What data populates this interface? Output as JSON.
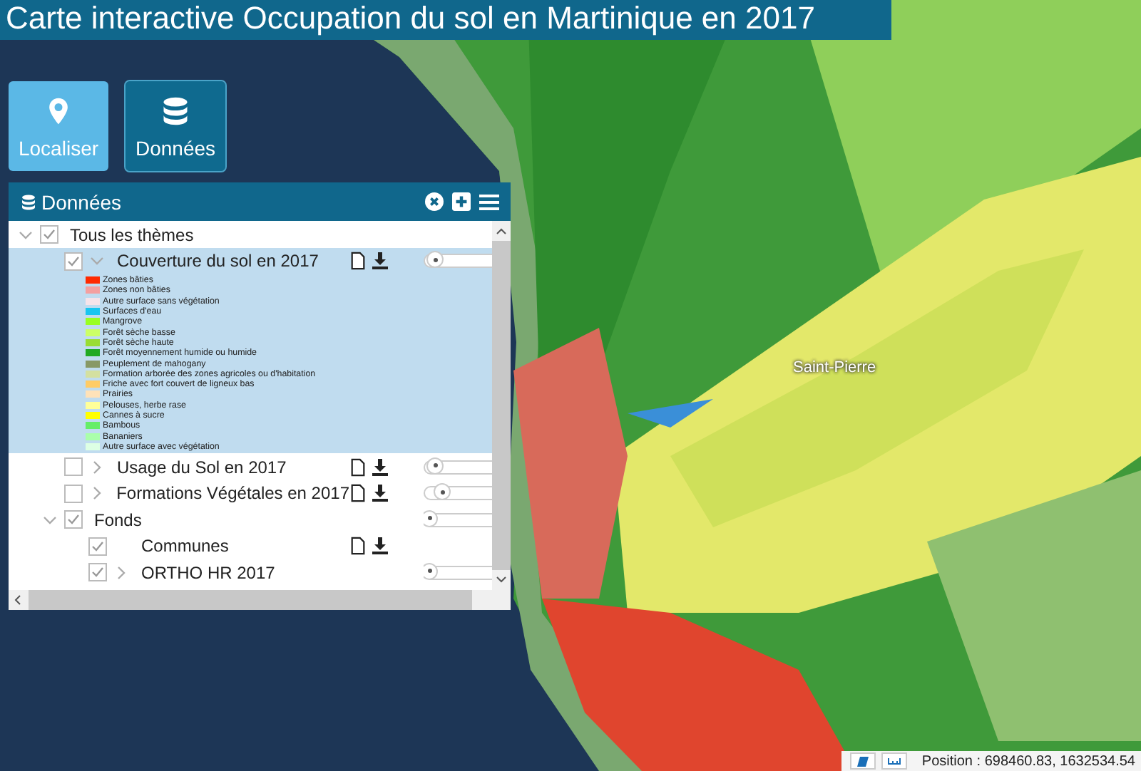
{
  "title": "Carte interactive Occupation du sol en Martinique en 2017",
  "tools": [
    {
      "label": "Localiser",
      "kind": "pin",
      "selected": false
    },
    {
      "label": "Données",
      "kind": "database",
      "selected": true
    }
  ],
  "map": {
    "place_label": "Saint-Pierre"
  },
  "panel": {
    "title": "Données",
    "layers": [
      {
        "kind": "group",
        "label": "Tous les thèmes",
        "checked": true,
        "expanded": true,
        "selected": false,
        "children": [
          {
            "kind": "layer",
            "label": "Couverture du sol en 2017",
            "checked": true,
            "expanded": true,
            "selected": true,
            "downloadable": true,
            "level": 0.12,
            "legend": [
              {
                "label": "Zones bâties",
                "color": "#ff2a00"
              },
              {
                "label": "Zones non bâties",
                "color": "#f4a0a0"
              },
              {
                "label": "Autre surface sans végétation",
                "color": "#f6e4ea"
              },
              {
                "label": "Surfaces d'eau",
                "color": "#19c6f0"
              },
              {
                "label": "Mangrove",
                "color": "#99ff22"
              },
              {
                "label": "Forêt sèche basse",
                "color": "#ccff66"
              },
              {
                "label": "Forêt sèche haute",
                "color": "#99dd33"
              },
              {
                "label": "Forêt moyennement humide ou humide",
                "color": "#22aa22"
              },
              {
                "label": "Peuplement de mahogany",
                "color": "#889966"
              },
              {
                "label": "Formation arborée des zones agricoles ou d'habitation",
                "color": "#d4e0a0"
              },
              {
                "label": "Friche avec fort couvert de ligneux bas",
                "color": "#ffcc66"
              },
              {
                "label": "Prairies",
                "color": "#ffe2b8"
              },
              {
                "label": "Pelouses, herbe rase",
                "color": "#ffff99"
              },
              {
                "label": "Cannes à sucre",
                "color": "#ffff00"
              },
              {
                "label": "Bambous",
                "color": "#66ee66"
              },
              {
                "label": "Bananiers",
                "color": "#aaffaa"
              },
              {
                "label": "Autre surface avec végétation",
                "color": "#ddffe4"
              }
            ]
          },
          {
            "kind": "layer",
            "label": "Usage du Sol en 2017",
            "checked": false,
            "expanded": false,
            "selected": false,
            "downloadable": true,
            "level": 0.12
          },
          {
            "kind": "layer",
            "label": "Formations Végétales en 2017",
            "checked": false,
            "expanded": false,
            "selected": false,
            "downloadable": true,
            "level": 0.2
          },
          {
            "kind": "group",
            "label": "Fonds",
            "checked": true,
            "expanded": true,
            "selected": false,
            "level": 0.05,
            "children": [
              {
                "kind": "layer",
                "label": "Communes",
                "checked": true,
                "selected": false,
                "downloadable": true
              },
              {
                "kind": "layer",
                "label": "ORTHO HR 2017",
                "checked": true,
                "expanded": false,
                "selected": false,
                "downloadable": false,
                "level": 0.05
              }
            ]
          }
        ]
      }
    ]
  },
  "status_bar": {
    "position": "Position : 698460.83, 1632534.54"
  }
}
